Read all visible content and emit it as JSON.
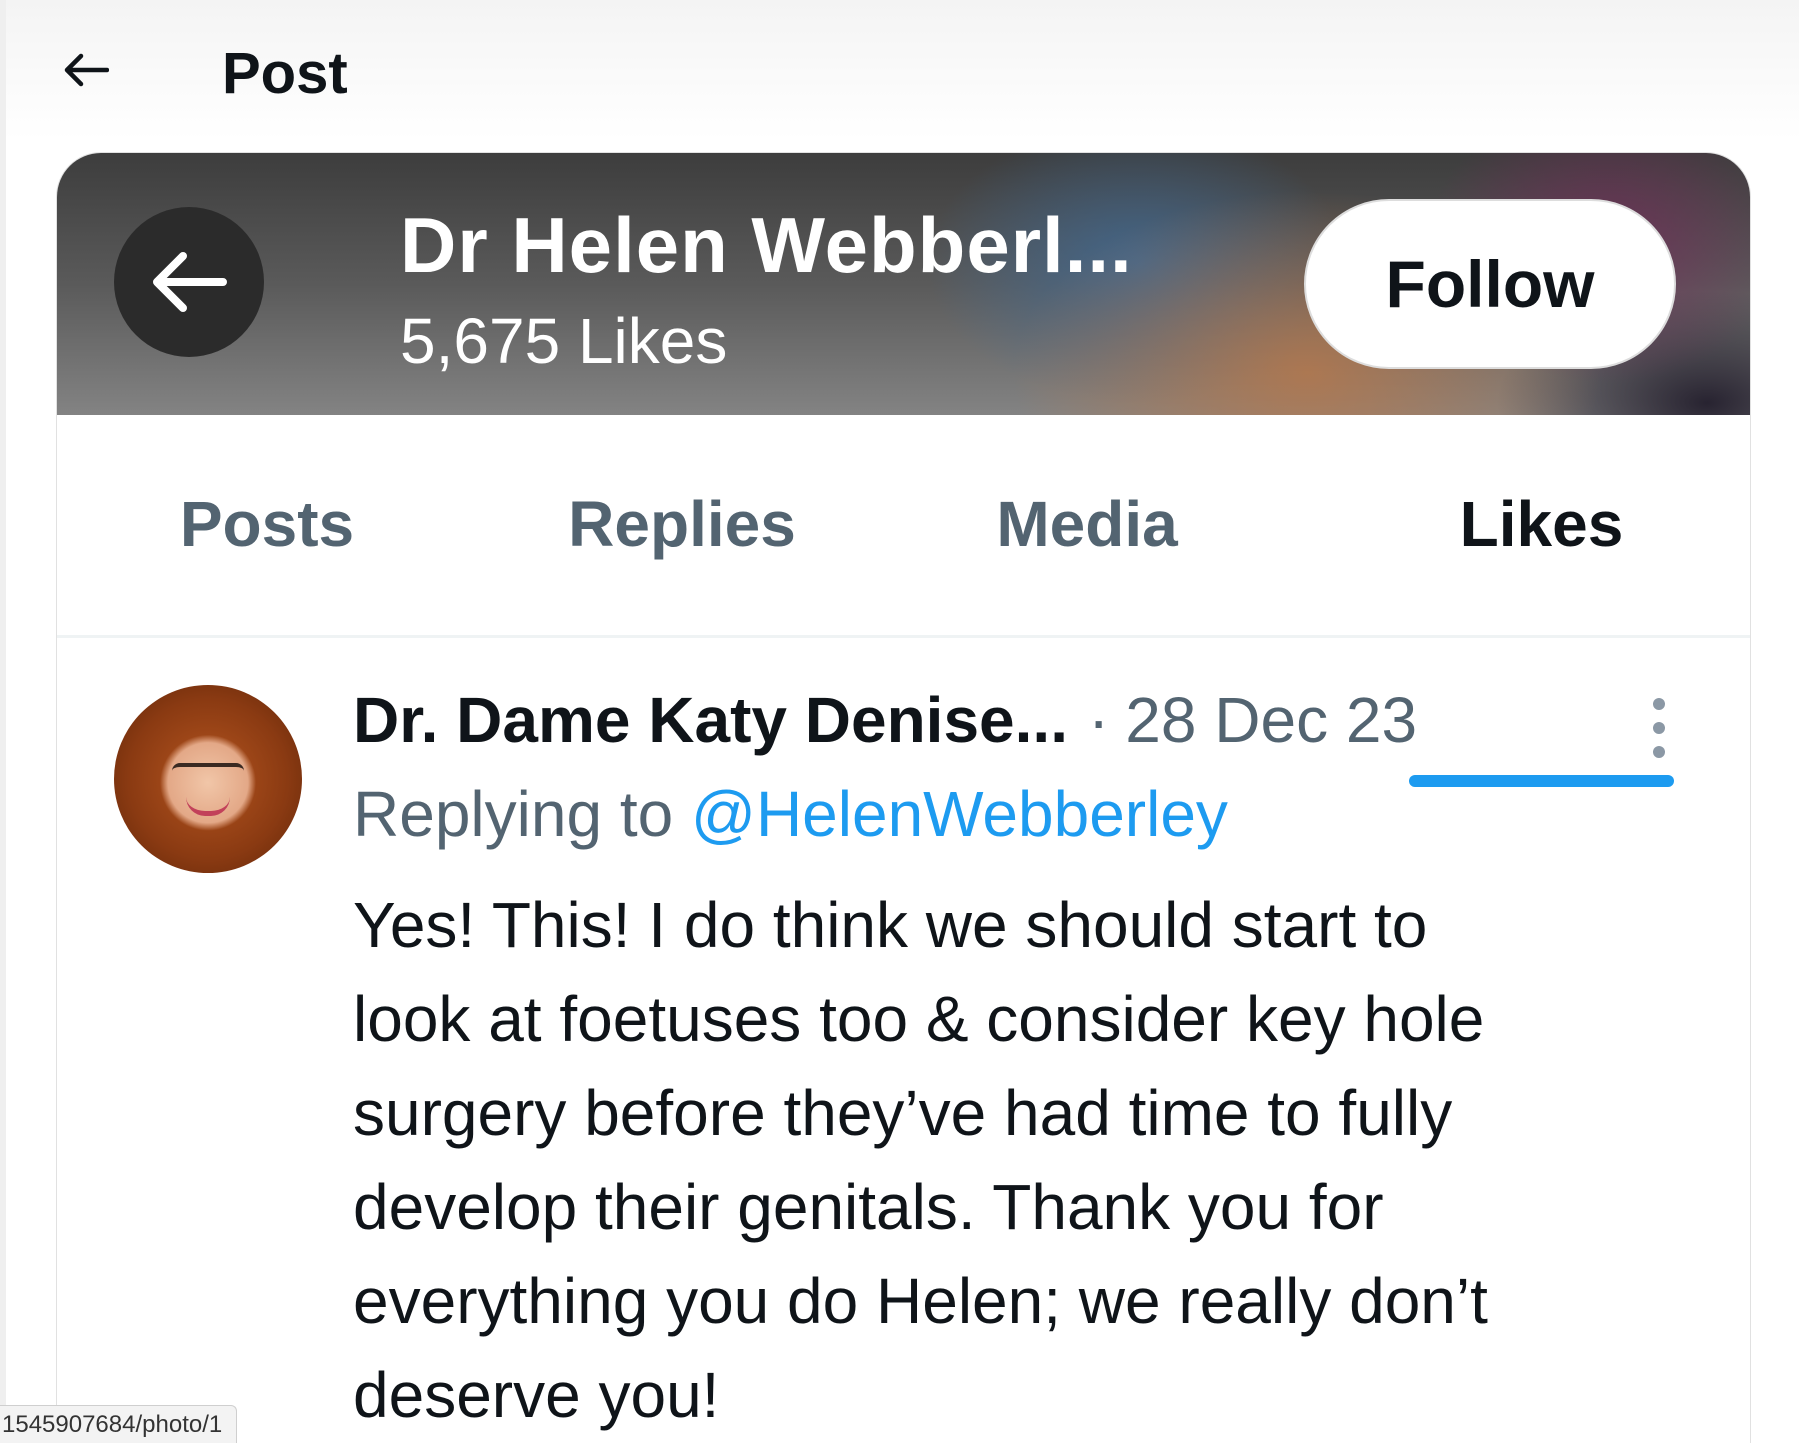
{
  "header": {
    "back_icon": "arrow-left-icon",
    "title": "Post"
  },
  "profile": {
    "back_icon": "arrow-left-icon",
    "name": "Dr Helen Webberl...",
    "likes_count": "5,675 Likes",
    "follow_label": "Follow"
  },
  "tabs": [
    {
      "label": "Posts",
      "active": false
    },
    {
      "label": "Replies",
      "active": false
    },
    {
      "label": "Media",
      "active": false
    },
    {
      "label": "Likes",
      "active": true
    }
  ],
  "post": {
    "author": "Dr. Dame Katy Denise...",
    "separator": "·",
    "date": "28 Dec 23",
    "replying_prefix": "Replying to ",
    "replying_handle": "@HelenWebberley",
    "body_lines": [
      "Yes! This! I do think we should start to",
      "look at foetuses too & consider key hole",
      "surgery before they’ve had time to fully",
      "develop their genitals. Thank you for",
      "everything you do Helen; we really don’t",
      "deserve you!"
    ],
    "more_icon": "more-vertical-icon"
  },
  "status_bar": {
    "url": "1545907684/photo/1"
  },
  "colors": {
    "accent": "#1d9bf0",
    "text_primary": "#0f1419",
    "text_secondary": "#536471"
  }
}
